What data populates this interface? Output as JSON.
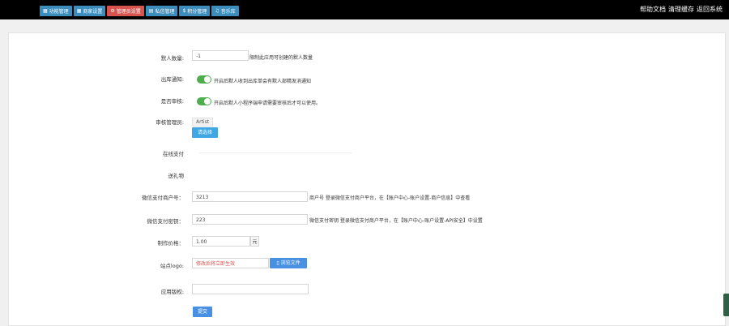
{
  "topnav": {
    "items": [
      {
        "label": "功能管理",
        "icon": "grid-icon",
        "glyph": "▦"
      },
      {
        "label": "商家设置",
        "icon": "grid-icon",
        "glyph": "▦"
      },
      {
        "label": "管理员设置",
        "icon": "gear-icon",
        "glyph": "⚙"
      },
      {
        "label": "私信管理",
        "icon": "chat-icon",
        "glyph": "▤"
      },
      {
        "label": "积分管理",
        "icon": "coin-icon",
        "glyph": "$"
      },
      {
        "label": "音乐库",
        "icon": "music-icon",
        "glyph": "♫"
      }
    ],
    "active_index": 2
  },
  "toplinks": [
    "帮助文档",
    "清理缓存",
    "返回系统"
  ],
  "form": {
    "max_people": {
      "label": "默人数量:",
      "value": "-1",
      "hint": "限制此应用可创建的默人数量"
    },
    "enter_notify": {
      "label": "出库通知:",
      "hint": "开启后默人收到出库单会有默人部精发消通知"
    },
    "audit": {
      "label": "是否审核:",
      "hint": "开启后默人小程序端申请需要审核后才可以使用。"
    },
    "auditor": {
      "label": "审核管理员:",
      "tag": "Artist",
      "button": "请选择"
    },
    "online_pay": {
      "label": "在线支付"
    },
    "gift": {
      "label": "送礼物"
    },
    "merchant_id": {
      "label": "微信支付商户号：",
      "value": "3213",
      "hint": "商户号 登录微信支付商户平台，在【账户中心-账户设置-商户信息】中查看"
    },
    "merchant_key": {
      "label": "微信支付密钥：",
      "value": "223",
      "hint": "微信支付密钥 登录微信支付商户平台，在【账户中心-账户设置-API安全】中设置"
    },
    "price": {
      "label": "制作价格：",
      "value": "1.00",
      "unit": "元"
    },
    "logo": {
      "label": "站点logo:",
      "placeholder_text": "修改后将立即生效",
      "button": "浏览文件"
    },
    "copyright": {
      "label": "应用版权:",
      "value": ""
    },
    "submit": "提交"
  },
  "colors": {
    "nav_blue": "#3c8dbc",
    "nav_active": "#d9534f",
    "toggle_on": "#4cae4c",
    "button_blue": "#3fa7e3"
  }
}
